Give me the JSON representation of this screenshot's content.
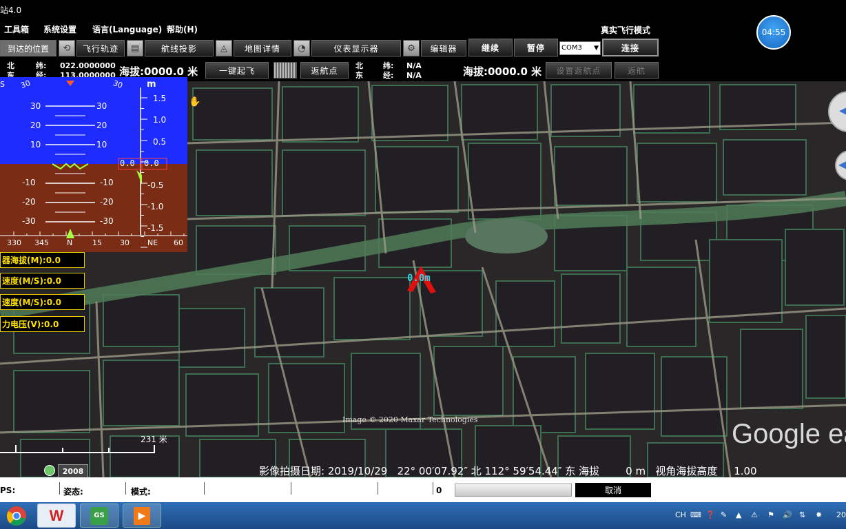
{
  "window": {
    "title": "站4.0"
  },
  "menu": [
    {
      "label": "工具箱"
    },
    {
      "label": "系统设置"
    },
    {
      "label": "语言(Language)"
    },
    {
      "label": "帮助(H)"
    }
  ],
  "flight_mode": "真实飞行模式",
  "clock": "04:55",
  "toolbar": {
    "reach_position": "到达的位置",
    "flight_track": "飞行轨迹",
    "route_photo": "航线投影",
    "map_detail": "地图详情",
    "instrument_display": "仪表显示器",
    "editor": "编辑器",
    "continue": "继续",
    "pause": "暂停",
    "com_port": "COM3",
    "connect": "连接",
    "takeoff": "一键起飞",
    "return_point": "返航点",
    "set_return_point": "设置返航点",
    "return": "返航"
  },
  "coords_left": {
    "north_label": "北",
    "east_label": "东",
    "lat_label": "纬:",
    "lon_label": "经:",
    "lat": "022.0000000",
    "lon": "113.0000000",
    "altitude": "海拔:0000.0 米"
  },
  "coords_right": {
    "north_label": "北",
    "east_label": "东",
    "lat_label": "纬:",
    "lon_label": "经:",
    "lat": "N/A",
    "lon": "N/A",
    "altitude": "海拔:0000.0 米"
  },
  "hud": {
    "heading_top": [
      "S",
      "30",
      "30"
    ],
    "unit": "m",
    "pitch_marks": [
      "30",
      "20",
      "10",
      "-10",
      "-20",
      "-30"
    ],
    "vs_scale": [
      "1.5",
      "1.0",
      "0.5",
      "-0.5",
      "-1.0",
      "-1.5"
    ],
    "vs_value": "0.0",
    "alt_value": "0.0",
    "heading_scale": [
      "330",
      "345",
      "N",
      "15",
      "30",
      "NE",
      "60"
    ]
  },
  "data_panel": [
    {
      "label": "器海拔(M):0.0"
    },
    {
      "label": "速度(M/S):0.0"
    },
    {
      "label": "速度(M/S):0.0"
    },
    {
      "label": "力电压(V):0.0"
    }
  ],
  "map": {
    "aircraft_label": "0.0m",
    "copyright": "Image © 2020 Maxar Technologies",
    "scale_label": "231 米",
    "history_year": "2008",
    "logo": "Google ea",
    "status_line": "影像拍摄日期: 2019/10/29   22° 00′07.92″ 北 112° 59′54.44″ 东 海拔        0 m   视角海拔高度     1.00"
  },
  "statusbar": {
    "gps": "PS:",
    "attitude": "姿态:",
    "mode": "模式:",
    "count": "0",
    "cancel": "取消"
  },
  "taskbar": {
    "gs_label": "GS",
    "lang": "CH",
    "date_partial": "20"
  }
}
